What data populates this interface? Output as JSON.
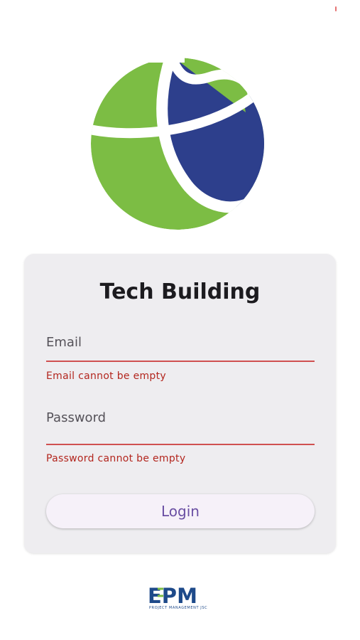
{
  "app": {
    "title": "Tech Building"
  },
  "form": {
    "email": {
      "label": "Email",
      "value": "",
      "error": "Email cannot be empty"
    },
    "password": {
      "label": "Password",
      "value": "",
      "error": "Password cannot be empty"
    },
    "login_label": "Login"
  },
  "footer": {
    "logo_text": "EPM",
    "tagline": "PROJECT MANAGEMENT JSC"
  },
  "colors": {
    "logo_green": "#7cbd44",
    "logo_blue": "#2d3f8c",
    "error_red": "#b3261e",
    "button_text": "#6a4fa3",
    "card_bg": "#eeedf0"
  },
  "icons": {
    "app_logo": "tech-building-logo-icon",
    "footer_logo": "epm-logo-icon"
  }
}
